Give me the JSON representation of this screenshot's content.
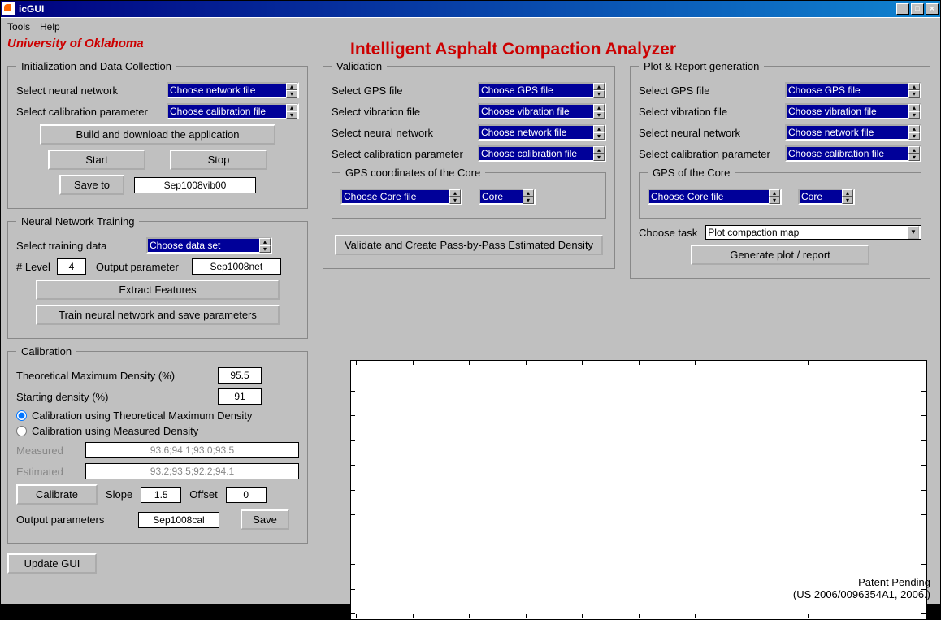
{
  "window": {
    "title": "icGUI"
  },
  "menubar": [
    "Tools",
    "Help"
  ],
  "header": {
    "university": "University of Oklahoma",
    "app_title": "Intelligent Asphalt Compaction Analyzer"
  },
  "init": {
    "legend": "Initialization and Data Collection",
    "select_nn_label": "Select neural network",
    "select_nn_value": "Choose network file",
    "select_cal_label": "Select calibration parameter",
    "select_cal_value": "Choose calibration file",
    "build_btn": "Build and download the application",
    "start_btn": "Start",
    "stop_btn": "Stop",
    "save_to_btn": "Save to",
    "save_to_value": "Sep1008vib00"
  },
  "training": {
    "legend": "Neural Network Training",
    "select_train_label": "Select training data",
    "select_train_value": "Choose data set",
    "level_label": "# Level",
    "level_value": "4",
    "output_param_label": "Output parameter",
    "output_param_value": "Sep1008net",
    "extract_btn": "Extract Features",
    "train_btn": "Train neural network and save parameters"
  },
  "calibration": {
    "legend": "Calibration",
    "tmd_label": "Theoretical Maximum Density (%)",
    "tmd_value": "95.5",
    "start_density_label": "Starting density (%)",
    "start_density_value": "91",
    "radio_tmd": "Calibration using Theoretical Maximum Density",
    "radio_measured": "Calibration using Measured Density",
    "measured_label": "Measured",
    "measured_value": "93.6;94.1;93.0;93.5",
    "estimated_label": "Estimated",
    "estimated_value": "93.2;93.5;92.2;94.1",
    "calibrate_btn": "Calibrate",
    "slope_label": "Slope",
    "slope_value": "1.5",
    "offset_label": "Offset",
    "offset_value": "0",
    "out_params_label": "Output parameters",
    "out_params_value": "Sep1008cal",
    "save_btn": "Save"
  },
  "update_gui_btn": "Update GUI",
  "validation": {
    "legend": "Validation",
    "gps_label": "Select GPS file",
    "gps_value": "Choose GPS file",
    "vib_label": "Select vibration file",
    "vib_value": "Choose vibration file",
    "nn_label": "Select neural network",
    "nn_value": "Choose network file",
    "cal_label": "Select calibration parameter",
    "cal_value": "Choose calibration file",
    "gps_core_legend": "GPS coordinates of the Core",
    "core_file_value": "Choose Core file",
    "core_label": "Core",
    "validate_btn": "Validate and Create Pass-by-Pass Estimated Density"
  },
  "plotreport": {
    "legend": "Plot & Report generation",
    "gps_label": "Select GPS file",
    "gps_value": "Choose GPS file",
    "vib_label": "Select vibration file",
    "vib_value": "Choose vibration file",
    "nn_label": "Select neural network",
    "nn_value": "Choose network file",
    "cal_label": "Select calibration parameter",
    "cal_value": "Choose calibration file",
    "gps_core_legend": "GPS of the Core",
    "core_file_value": "Choose Core file",
    "core_label": "Core",
    "task_label": "Choose task",
    "task_value": "Plot compaction map",
    "generate_btn": "Generate plot / report"
  },
  "patent": {
    "line1": "Patent Pending",
    "line2": "(US 2006/0096354A1, 2006.)"
  }
}
